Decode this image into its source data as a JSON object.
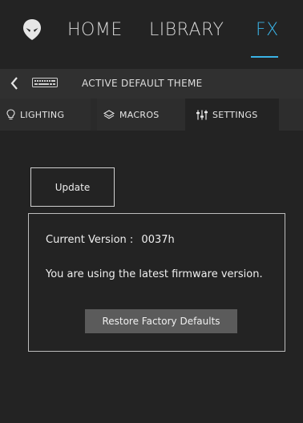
{
  "nav": {
    "items": [
      {
        "label": "HOME"
      },
      {
        "label": "LIBRARY"
      },
      {
        "label": "FX",
        "active": true
      }
    ],
    "logo_icon": "alien-head-icon",
    "accent_color": "#3ab3e6"
  },
  "breadcrumb": {
    "back_icon": "chevron-left-icon",
    "device_icon": "keyboard-icon",
    "title": "ACTIVE DEFAULT THEME"
  },
  "tabs": [
    {
      "label": "LIGHTING",
      "icon": "lightbulb-icon"
    },
    {
      "label": "MACROS",
      "icon": "layers-icon"
    },
    {
      "label": "SETTINGS",
      "icon": "sliders-icon",
      "active": true
    }
  ],
  "settings": {
    "update_label": "Update",
    "version_label": "Current Version :",
    "version_value": "0037h",
    "firmware_message": "You are using the latest firmware version.",
    "restore_label": "Restore Factory Defaults"
  }
}
